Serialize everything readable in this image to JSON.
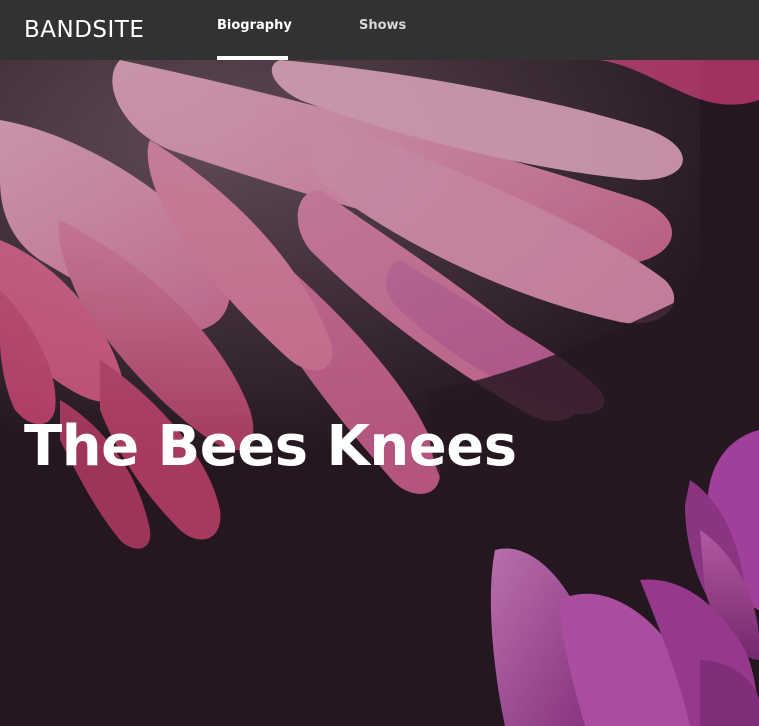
{
  "header": {
    "logo_text": "BANDSITE",
    "nav": [
      {
        "label": "Biography",
        "active": true
      },
      {
        "label": "Shows",
        "active": false
      }
    ]
  },
  "hero": {
    "title": "The Bees Knees",
    "background_image": "pink-daisy-petals-photo"
  },
  "colors": {
    "header_bg": "#323232",
    "hero_dark": "#2a1c26",
    "petal_pink": "#e8649b",
    "petal_light": "#f2a2c6",
    "petal_magenta": "#c04bb8"
  }
}
